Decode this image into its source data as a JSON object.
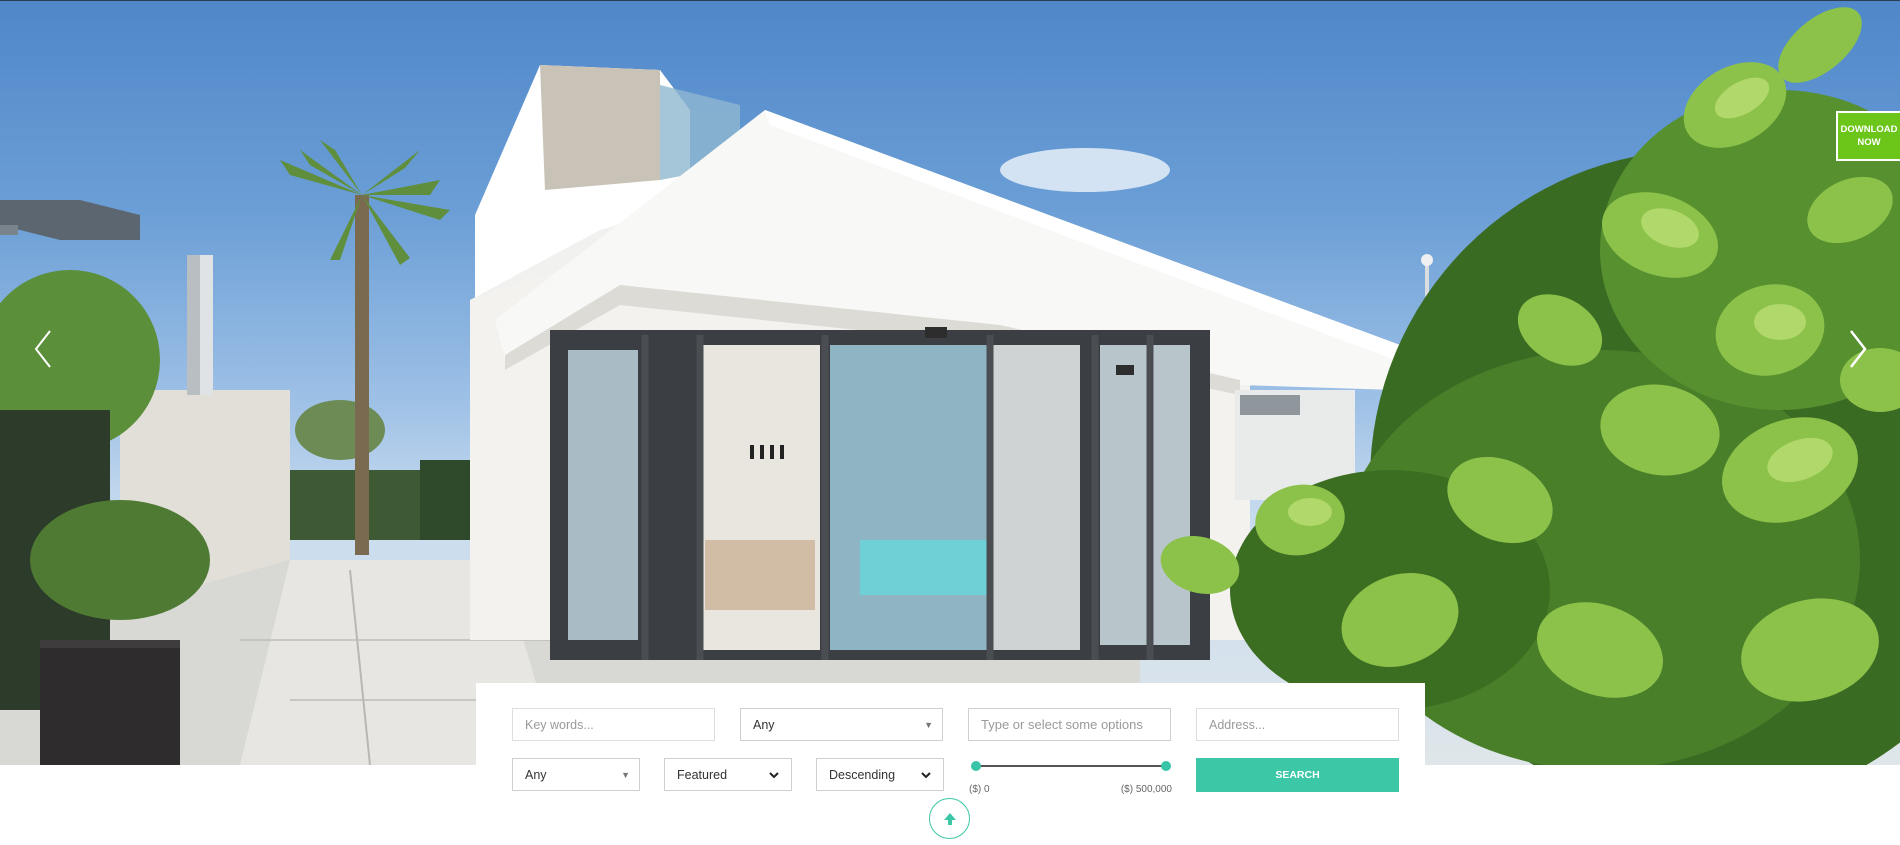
{
  "hero": {
    "prev_icon": "chevron-left-icon",
    "next_icon": "chevron-right-icon",
    "download_line1": "DOWNLOAD",
    "download_line2": "NOW"
  },
  "search": {
    "keywords_placeholder": "Key words...",
    "type_value": "Any",
    "options_placeholder": "Type or select some options",
    "address_placeholder": "Address...",
    "status_value": "Any",
    "sort_value": "Featured",
    "order_value": "Descending",
    "price_min_label": "($) 0",
    "price_max_label": "($) 500,000",
    "price_range": {
      "min": 0,
      "max": 500000
    },
    "search_label": "SEARCH",
    "accent_color": "#3cc7a6"
  },
  "scroll_top_icon": "arrow-up-icon",
  "colors": {
    "download": "#6cc519",
    "accent": "#3cc7a6"
  }
}
